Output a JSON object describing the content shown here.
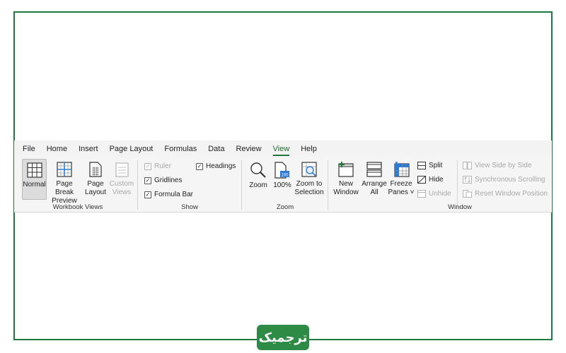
{
  "menu": [
    "File",
    "Home",
    "Insert",
    "Page Layout",
    "Formulas",
    "Data",
    "Review",
    "View",
    "Help"
  ],
  "active_menu": "View",
  "groups": {
    "workbook_views": {
      "label": "Workbook Views",
      "normal": "Normal",
      "page_break": [
        "Page Break",
        "Preview"
      ],
      "page_layout": [
        "Page",
        "Layout"
      ],
      "custom_views": [
        "Custom",
        "Views"
      ]
    },
    "show": {
      "label": "Show",
      "ruler": "Ruler",
      "gridlines": "Gridlines",
      "formula_bar": "Formula Bar",
      "headings": "Headings"
    },
    "zoom": {
      "label": "Zoom",
      "zoom": "Zoom",
      "hundred": "100%",
      "hundred_icon_text": "100",
      "zoom_selection": [
        "Zoom to",
        "Selection"
      ]
    },
    "window": {
      "label": "Window",
      "new_window": [
        "New",
        "Window"
      ],
      "arrange_all": [
        "Arrange",
        "All"
      ],
      "freeze_panes": [
        "Freeze",
        "Panes ˅"
      ],
      "split": "Split",
      "hide": "Hide",
      "unhide": "Unhide",
      "view_side": "View Side by Side",
      "sync_scroll": "Synchronous Scrolling",
      "reset_pos": "Reset Window Position"
    }
  },
  "watermark": "ترجمیک",
  "colors": {
    "frame": "#1e7a3c",
    "logo_bg": "#2e8b45",
    "accent": "#1e7a3c"
  }
}
